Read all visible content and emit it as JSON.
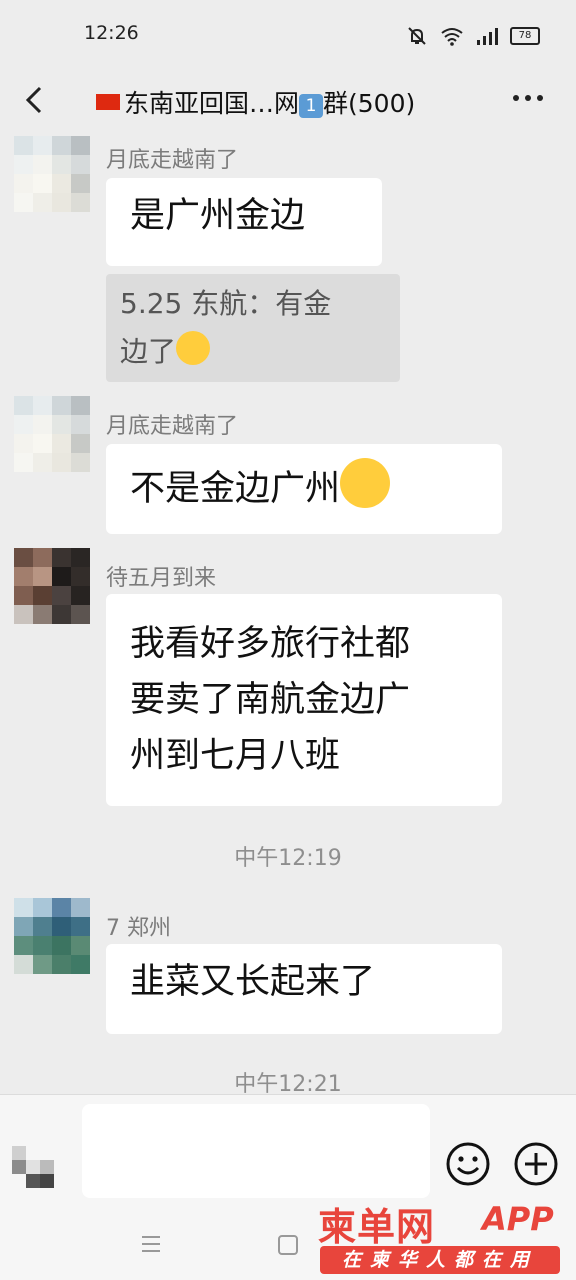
{
  "status_bar": {
    "time": "12:26",
    "battery": "78"
  },
  "header": {
    "title_main": "东南亚回国…网",
    "title_badge": "1",
    "title_suffix": "群(500)"
  },
  "messages": [
    {
      "sender": "月底走越南了",
      "text": "是广州金边",
      "quote_line1": "5.25 东航：有金",
      "quote_line2": "边了"
    },
    {
      "sender": "月底走越南了",
      "text": "不是金边广州"
    },
    {
      "sender": "待五月到来",
      "lines": [
        "我看好多旅行社都",
        "要卖了南航金边广",
        "州到七月八班"
      ]
    },
    {
      "timestamp": "中午12:19"
    },
    {
      "sender": "7 郑州",
      "text": "韭菜又长起来了"
    },
    {
      "timestamp": "中午12:21"
    }
  ],
  "input": {
    "placeholder": ""
  },
  "watermark": {
    "logo": "柬单网",
    "app": "APP",
    "slogan": "在柬华人都在用"
  },
  "colors": {
    "background": "#ededed",
    "bubble": "#ffffff",
    "watermark": "#e8453c"
  }
}
